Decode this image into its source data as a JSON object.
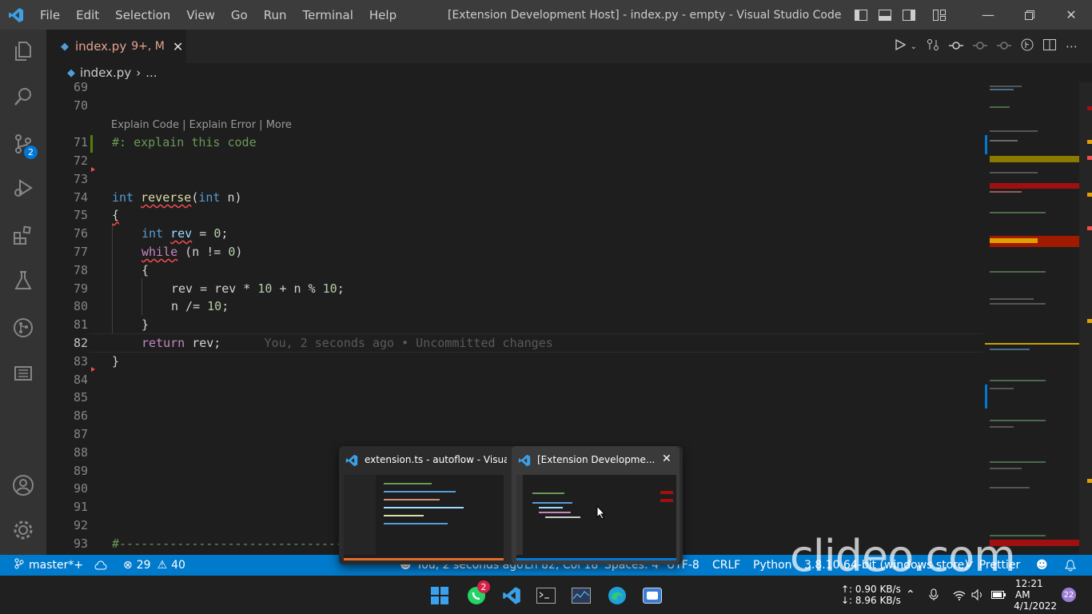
{
  "titlebar": {
    "menu": [
      "File",
      "Edit",
      "Selection",
      "View",
      "Go",
      "Run",
      "Terminal",
      "Help"
    ],
    "window_title": "[Extension Development Host] - index.py - empty - Visual Studio Code"
  },
  "activity": {
    "scm_badge": "2"
  },
  "tab": {
    "name": "index.py",
    "mods": "9+, M"
  },
  "breadcrumb": {
    "file": "index.py",
    "sep": "›",
    "rest": "..."
  },
  "codelens": "Explain Code | Explain Error | More",
  "lines": {
    "l69": "69",
    "l70": "70",
    "l71": "71",
    "l72": "72",
    "l73": "73",
    "l74": "74",
    "l75": "75",
    "l76": "76",
    "l77": "77",
    "l78": "78",
    "l79": "79",
    "l80": "80",
    "l81": "81",
    "l82": "82",
    "l83": "83",
    "l84": "84",
    "l85": "85",
    "l86": "86",
    "l87": "87",
    "l88": "88",
    "l89": "89",
    "l90": "90",
    "l91": "91",
    "l92": "92",
    "l93": "93"
  },
  "code": {
    "c71": "#: explain this code",
    "kw_int": "int",
    "fn_reverse": "reverse",
    "paren_open": "(",
    "param_n": " n)",
    "brace_open": "{",
    "brace_close": "}",
    "rev": "rev",
    "eq0": " = ",
    "zero": "0",
    "semi": ";",
    "while": "while",
    "cond_a": " (n != ",
    "cond_b": ")",
    "l79_a": "rev = rev * ",
    "ten": "10",
    "l79_b": " + n % ",
    "l80_a": "n /= ",
    "return": "return",
    "ret_rest": " rev;",
    "blame": "You, 2 seconds ago • Uncommitted changes",
    "l93": "#---------------------------------"
  },
  "status": {
    "branch": "master*+",
    "errors": "29",
    "warnings": "40",
    "blame": "You, 2 seconds ago",
    "position": "Ln 82, Col 18",
    "spaces": "Spaces: 4",
    "encoding": "UTF-8",
    "eol": "CRLF",
    "language": "Python",
    "interpreter": "3.8.10 64-bit (windows store)",
    "prettier": "Prettier"
  },
  "preview": {
    "left_title": "extension.ts - autoflow - Visual...",
    "right_title": "[Extension Developme..."
  },
  "taskbar": {
    "whatsapp_badge": "2",
    "net_up": "↑: 0.90 KB/s",
    "net_down": "↓: 8.96 KB/s",
    "time": "12:21 AM",
    "date": "4/1/2022",
    "notif_count": "22"
  },
  "watermark": "clideo.com",
  "colors": {
    "accent": "#007acc",
    "status_bar": "#007acc",
    "tab_modified": "#e5a48e",
    "error": "#f14c4c"
  }
}
